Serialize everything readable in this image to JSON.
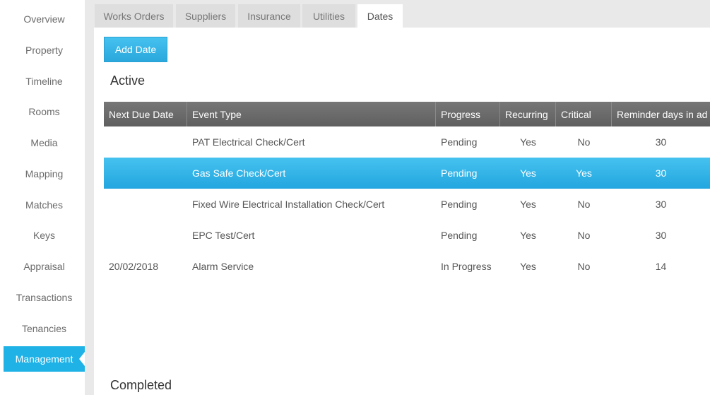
{
  "sidebar": {
    "items": [
      {
        "label": "Overview"
      },
      {
        "label": "Property"
      },
      {
        "label": "Timeline"
      },
      {
        "label": "Rooms"
      },
      {
        "label": "Media"
      },
      {
        "label": "Mapping"
      },
      {
        "label": "Matches"
      },
      {
        "label": "Keys"
      },
      {
        "label": "Appraisal"
      },
      {
        "label": "Transactions"
      },
      {
        "label": "Tenancies"
      },
      {
        "label": "Management"
      }
    ],
    "active": "Management"
  },
  "tabs": [
    {
      "label": "Works Orders"
    },
    {
      "label": "Suppliers"
    },
    {
      "label": "Insurance"
    },
    {
      "label": "Utilities"
    },
    {
      "label": "Dates"
    }
  ],
  "active_tab": "Dates",
  "toolbar": {
    "add_date_label": "Add Date"
  },
  "sections": {
    "active_title": "Active",
    "completed_title": "Completed"
  },
  "table": {
    "columns": [
      "Next Due Date",
      "Event Type",
      "Progress",
      "Recurring",
      "Critical",
      "Reminder days in ad"
    ],
    "rows": [
      {
        "due": "",
        "event": "PAT Electrical Check/Cert",
        "progress": "Pending",
        "recurring": "Yes",
        "critical": "No",
        "reminder": "30"
      },
      {
        "due": "",
        "event": "Gas Safe Check/Cert",
        "progress": "Pending",
        "recurring": "Yes",
        "critical": "Yes",
        "reminder": "30"
      },
      {
        "due": "",
        "event": "Fixed Wire Electrical Installation Check/Cert",
        "progress": "Pending",
        "recurring": "Yes",
        "critical": "No",
        "reminder": "30"
      },
      {
        "due": "",
        "event": "EPC Test/Cert",
        "progress": "Pending",
        "recurring": "Yes",
        "critical": "No",
        "reminder": "30"
      },
      {
        "due": "20/02/2018",
        "event": "Alarm Service",
        "progress": "In Progress",
        "recurring": "Yes",
        "critical": "No",
        "reminder": "14"
      }
    ],
    "selected_row": "Gas Safe Check/Cert"
  },
  "colors": {
    "accent": "#1fb2e6",
    "header_bg": "#6b6b6b",
    "tabbar_bg": "#e9e9e9"
  }
}
